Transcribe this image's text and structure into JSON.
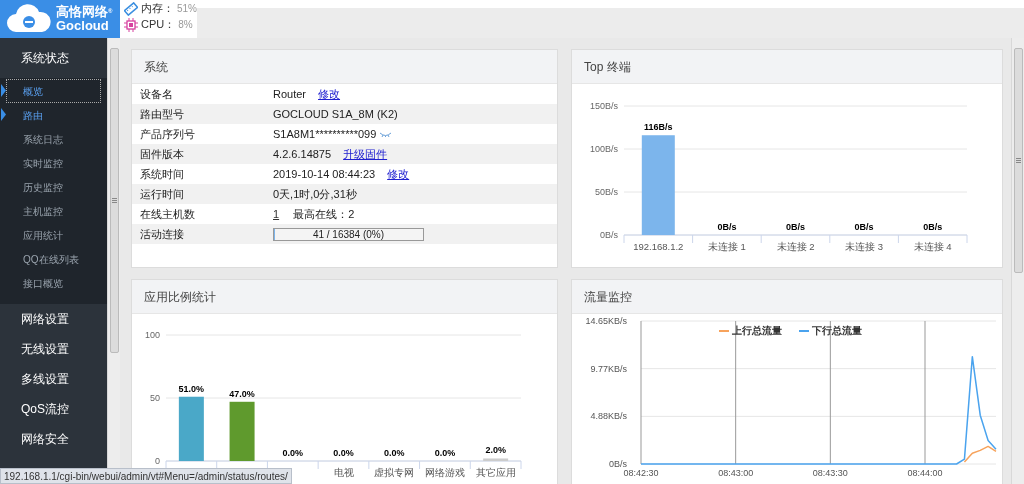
{
  "header": {
    "logo": {
      "cn": "高恪网络",
      "en": "Gocloud",
      "mark": "®"
    },
    "stats": [
      {
        "kind": "memory",
        "label": "内存：",
        "value": "51%"
      },
      {
        "kind": "cpu",
        "label": "CPU：",
        "value": "8%"
      }
    ]
  },
  "sidebar": {
    "sections": [
      {
        "label": "系统状态",
        "expanded": true,
        "children": [
          {
            "label": "概览",
            "selected": true,
            "kind": "marker"
          },
          {
            "label": "路由",
            "selected": false,
            "kind": "marker"
          },
          {
            "label": "系统日志",
            "selected": false,
            "kind": "plain"
          },
          {
            "label": "实时监控",
            "selected": false,
            "kind": "plain"
          },
          {
            "label": "历史监控",
            "selected": false,
            "kind": "plain"
          },
          {
            "label": "主机监控",
            "selected": false,
            "kind": "plain"
          },
          {
            "label": "应用统计",
            "selected": false,
            "kind": "plain"
          },
          {
            "label": "QQ在线列表",
            "selected": false,
            "kind": "plain"
          },
          {
            "label": "接口概览",
            "selected": false,
            "kind": "plain"
          }
        ]
      },
      {
        "label": "网络设置",
        "expanded": false
      },
      {
        "label": "无线设置",
        "expanded": false
      },
      {
        "label": "多线设置",
        "expanded": false
      },
      {
        "label": "QoS流控",
        "expanded": false
      },
      {
        "label": "网络安全",
        "expanded": false
      }
    ]
  },
  "system": {
    "title": "系统",
    "rows": [
      {
        "kind": "link",
        "label": "设备名",
        "value": "Router",
        "link": "修改"
      },
      {
        "kind": "text",
        "label": "路由型号",
        "value": "GOCLOUD S1A_8M (K2)"
      },
      {
        "kind": "serial",
        "label": "产品序列号",
        "value": "S1A8M1**********099"
      },
      {
        "kind": "link",
        "label": "固件版本",
        "value": "4.2.6.14875",
        "link": "升级固件"
      },
      {
        "kind": "link",
        "label": "系统时间",
        "value": "2019-10-14 08:44:23",
        "link": "修改"
      },
      {
        "kind": "text",
        "label": "运行时间",
        "value": "0天,1时,0分,31秒"
      },
      {
        "kind": "hosts",
        "label": "在线主机数",
        "value": "1",
        "extra_label": "最高在线：",
        "extra_value": "2"
      },
      {
        "kind": "meter",
        "label": "活动连接",
        "value": "41 / 16384 (0%)",
        "level": 0.0025
      }
    ]
  },
  "top_terminals": {
    "title": "Top 终端",
    "chart_data": {
      "type": "bar",
      "categories": [
        "192.168.1.2",
        "未连接 1",
        "未连接 2",
        "未连接 3",
        "未连接 4"
      ],
      "series": [
        {
          "color": "#7cb5ec",
          "values": [
            116,
            0,
            0,
            0,
            0
          ]
        }
      ],
      "ylim": [
        0,
        150
      ],
      "yticks": [
        {
          "value": 0,
          "label": "0B/s"
        },
        {
          "value": 50,
          "label": "50B/s"
        },
        {
          "value": 100,
          "label": "100B/s"
        },
        {
          "value": 150,
          "label": "150B/s"
        }
      ],
      "value_labels": [
        "116B/s",
        "0B/s",
        "0B/s",
        "0B/s",
        "0B/s"
      ]
    }
  },
  "app_stats": {
    "title": "应用比例统计",
    "chart_data": {
      "type": "bar",
      "categories": [
        null,
        null,
        null,
        "电视",
        "虚拟专网",
        "网络游戏",
        "其它应用"
      ],
      "series": [
        {
          "color": "#4aa8c8",
          "values": [
            51,
            null,
            null,
            null,
            null,
            null,
            null
          ]
        },
        {
          "color": "#5f9a2d",
          "values": [
            null,
            47,
            null,
            null,
            null,
            null,
            null
          ]
        },
        {
          "color": "#cccccc",
          "values": [
            null,
            null,
            0,
            0,
            0,
            0,
            2
          ]
        }
      ],
      "ylim": [
        0,
        100
      ],
      "yticks": [
        0,
        50,
        100
      ],
      "value_labels": [
        "51.0%",
        "47.0%",
        "0.0%",
        "0.0%",
        "0.0%",
        "0.0%",
        "2.0%"
      ]
    }
  },
  "traffic": {
    "title": "流量监控",
    "chart_data": {
      "type": "line",
      "categories": [
        "08:42:30",
        null,
        null,
        null,
        null,
        null,
        null,
        null,
        null,
        null,
        null,
        null,
        "08:43:00",
        null,
        null,
        null,
        null,
        null,
        null,
        null,
        null,
        null,
        null,
        null,
        "08:43:30",
        null,
        null,
        null,
        null,
        null,
        null,
        null,
        null,
        null,
        null,
        null,
        "08:44:00",
        null,
        null,
        null,
        null,
        null,
        null,
        null,
        null,
        null
      ],
      "series": [
        {
          "name": "上行总流量",
          "color": "#f7a35c",
          "values": [
            null,
            null,
            null,
            null,
            null,
            null,
            null,
            null,
            null,
            null,
            null,
            null,
            null,
            null,
            null,
            null,
            null,
            null,
            null,
            null,
            null,
            null,
            null,
            null,
            null,
            null,
            null,
            null,
            null,
            null,
            null,
            null,
            null,
            null,
            null,
            null,
            null,
            null,
            null,
            null,
            null,
            0.2,
            1.1,
            1.4,
            1.8,
            1.3
          ]
        },
        {
          "name": "下行总流量",
          "color": "#4aa3ee",
          "values": [
            0,
            0,
            0,
            0,
            0,
            0,
            0,
            0,
            0,
            0,
            0,
            0,
            0,
            0,
            0,
            0,
            0,
            0,
            0,
            0,
            0,
            0,
            0,
            0,
            0,
            0,
            0,
            0,
            0,
            0,
            0,
            0,
            0,
            0,
            0,
            0,
            0,
            0,
            0,
            0,
            0,
            0.5,
            11,
            5,
            2.4,
            1.5
          ]
        }
      ],
      "ylim": [
        0,
        14.65
      ],
      "grid": true,
      "legend": true,
      "yticks": [
        {
          "value": 0,
          "label": "0B/s"
        },
        {
          "value": 4.88,
          "label": "4.88KB/s"
        },
        {
          "value": 9.77,
          "label": "9.77KB/s"
        },
        {
          "value": 14.65,
          "label": "14.65KB/s"
        }
      ]
    }
  },
  "status_bar": {
    "url": "192.168.1.1/cgi-bin/webui/admin/vt#Menu=/admin/status/routes/"
  }
}
